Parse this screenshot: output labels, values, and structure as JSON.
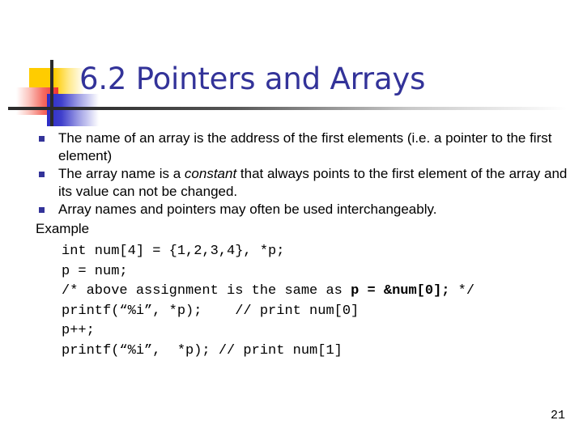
{
  "slide": {
    "title": "6.2 Pointers and Arrays",
    "title_color": "#333399",
    "page_number": "21",
    "background_color": "#ffffff"
  },
  "decoration": {
    "yellow_square": "yellow-gradient-square",
    "red_square": "red-gradient-square",
    "blue_square": "blue-gradient-square",
    "vertical_rule": "vertical-rule",
    "horizontal_rule": "horizontal-rule",
    "yellow_color": "#FFCC00",
    "red_color": "#F03030",
    "blue_color": "#2C2CC4",
    "rule_color": "#2b2b2b"
  },
  "bullets": [
    {
      "marker": "square-bullet",
      "pre": "The name of an array is the address of the first elements (i.e. a pointer to the first element)",
      "italic": "",
      "post": ""
    },
    {
      "marker": "square-bullet",
      "pre": "The array name is a ",
      "italic": "constant",
      "post": " that always points to the first element of the array and its value can not be changed."
    },
    {
      "marker": "square-bullet",
      "pre": "Array names and pointers may often be used interchangeably.",
      "italic": "",
      "post": ""
    }
  ],
  "example": {
    "label": "Example",
    "code_lines": [
      {
        "pre": "int num[4] = {1,2,3,4}, *p;",
        "bold": "",
        "post": ""
      },
      {
        "pre": "p = num;",
        "bold": "",
        "post": ""
      },
      {
        "pre": "/* above assignment is the same as ",
        "bold": "p = &num[0];",
        "post": " */"
      },
      {
        "pre": "printf(“%i”, *p);    // print num[0]",
        "bold": "",
        "post": ""
      },
      {
        "pre": "p++;",
        "bold": "",
        "post": ""
      },
      {
        "pre": "printf(“%i”,  *p); // print num[1]",
        "bold": "",
        "post": ""
      }
    ]
  },
  "bullet_marker_color": "#333399"
}
